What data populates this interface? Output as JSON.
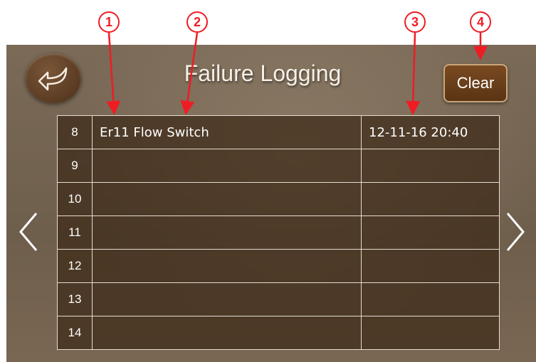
{
  "callouts": [
    "1",
    "2",
    "3",
    "4"
  ],
  "header": {
    "title": "Failure Logging",
    "clear_label": "Clear"
  },
  "icons": {
    "back": "back-arrow-icon",
    "prev": "chevron-left-icon",
    "next": "chevron-right-icon"
  },
  "log": {
    "rows": [
      {
        "index": "8",
        "description": "Er11 Flow Switch",
        "timestamp": "12-11-16 20:40"
      },
      {
        "index": "9",
        "description": "",
        "timestamp": ""
      },
      {
        "index": "10",
        "description": "",
        "timestamp": ""
      },
      {
        "index": "11",
        "description": "",
        "timestamp": ""
      },
      {
        "index": "12",
        "description": "",
        "timestamp": ""
      },
      {
        "index": "13",
        "description": "",
        "timestamp": ""
      },
      {
        "index": "14",
        "description": "",
        "timestamp": ""
      }
    ]
  },
  "colors": {
    "callout": "#ef1c24",
    "button_brown": "#5a3414",
    "table_border": "#e6ddd0"
  }
}
